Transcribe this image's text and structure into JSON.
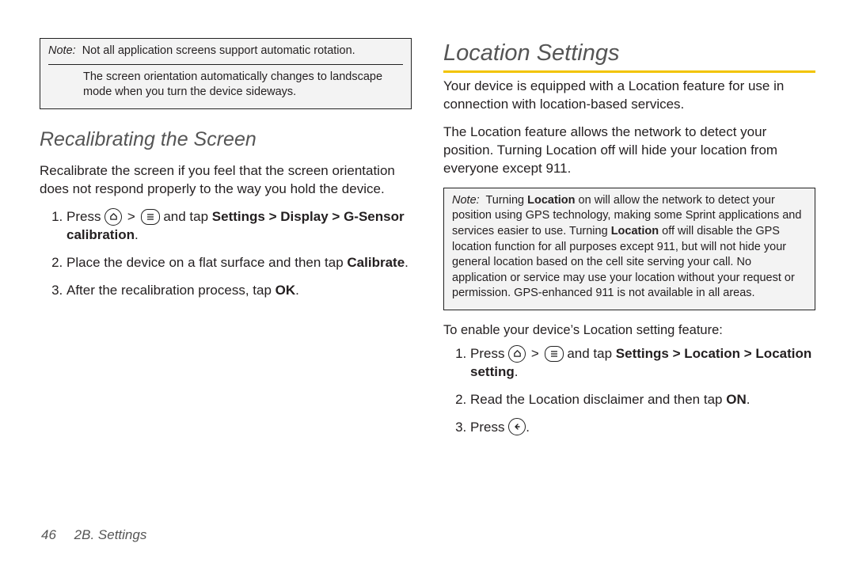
{
  "left": {
    "note1": {
      "label": "Note:",
      "line1": "Not all application screens support automatic rotation.",
      "line2": "The screen orientation automatically changes to landscape mode when you turn the device sideways."
    },
    "h2": "Recalibrating the Screen",
    "intro": "Recalibrate the screen if you feel that the screen orientation does not respond properly to the way you hold the device.",
    "step1_a": "Press ",
    "step1_b": " and tap ",
    "step1_bold": "Settings > Display > G-Sensor calibration",
    "step1_dot": ".",
    "step2_a": "Place the device on a flat surface and then tap ",
    "step2_bold": "Calibrate",
    "step2_dot": ".",
    "step3_a": "After the recalibration process, tap ",
    "step3_bold": "OK",
    "step3_dot": "."
  },
  "right": {
    "h1": "Location Settings",
    "p1": "Your device is equipped with a Location feature for use in connection with location-based services.",
    "p2": "The Location feature allows the network to detect your position. Turning Location off will hide your location from everyone except 911.",
    "note": {
      "label": "Note:",
      "a": "Turning ",
      "b1": "Location",
      "c": " on will allow the network to detect your position using GPS technology, making some Sprint applications and services easier to use. Turning ",
      "b2": "Location",
      "d": " off will disable the GPS location function for all purposes except 911, but will not hide your general location based on the cell site serving your call. No application or service may use your location without your request or permission. GPS-enhanced 911 is not available in all areas."
    },
    "lead": "To enable your device’s Location setting feature:",
    "step1_a": "Press ",
    "step1_b": " and tap ",
    "step1_bold": "Settings > Location > Location setting",
    "step1_dot": ".",
    "step2_a": "Read the Location disclaimer and then tap ",
    "step2_bold": "ON",
    "step2_dot": ".",
    "step3_a": "Press ",
    "step3_dot": "."
  },
  "footer": {
    "page": "46",
    "section": "2B. Settings"
  },
  "sym": {
    "gt": ">"
  }
}
